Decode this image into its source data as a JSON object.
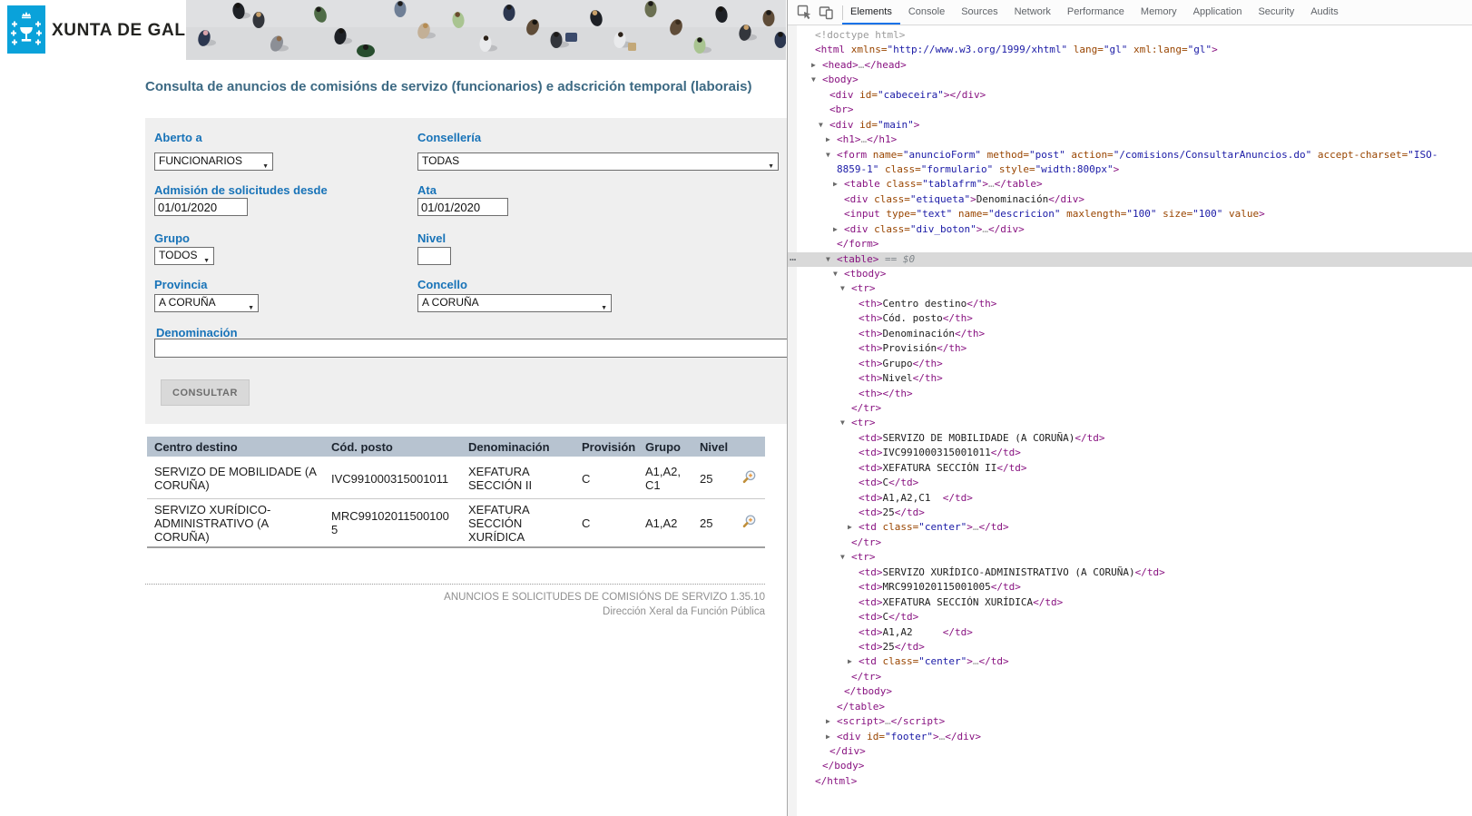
{
  "page": {
    "brand": "XUNTA DE GALICIA",
    "title": "Consulta de anuncios de comisións de servizo (funcionarios) e adscrición temporal (laborais)",
    "form": {
      "fields": [
        {
          "label": "Aberto a",
          "type": "select",
          "value": "FUNCIONARIOS"
        },
        {
          "label": "Consellería",
          "type": "select",
          "value": "TODAS"
        },
        {
          "label": "Admisión de solicitudes desde",
          "type": "text",
          "value": "01/01/2020"
        },
        {
          "label": "Ata",
          "type": "text",
          "value": "01/01/2020"
        },
        {
          "label": "Grupo",
          "type": "select",
          "value": "TODOS"
        },
        {
          "label": "Nivel",
          "type": "text",
          "value": ""
        },
        {
          "label": "Provincia",
          "type": "select",
          "value": "A CORUÑA"
        },
        {
          "label": "Concello",
          "type": "select",
          "value": "A CORUÑA"
        },
        {
          "label": "Denominación",
          "type": "text",
          "value": ""
        }
      ],
      "submit_label": "CONSULTAR"
    },
    "results": {
      "headers": [
        "Centro destino",
        "Cód. posto",
        "Denominación",
        "Provisión",
        "Grupo",
        "Nivel",
        ""
      ],
      "rows": [
        [
          "SERVIZO DE MOBILIDADE (A CORUÑA)",
          "IVC991000315001011",
          "XEFATURA SECCIÓN II",
          "C",
          "A1,A2,C1",
          "25"
        ],
        [
          "SERVIZO XURÍDICO-ADMINISTRATIVO (A CORUÑA)",
          "MRC991020115001005",
          "XEFATURA SECCIÓN XURÍDICA",
          "C",
          "A1,A2",
          "25"
        ]
      ],
      "row_action_icon": "magnifier-plus-icon"
    },
    "footer": {
      "line1": "ANUNCIOS E SOLICITUDES DE COMISIÓNS DE SERVIZO 1.35.10",
      "line2": "Dirección Xeral da Función Pública"
    },
    "colors": {
      "logo_blue": "#0aa2da",
      "label_blue": "#1873b8",
      "title_blue": "#3c6983",
      "form_bg": "#efefef",
      "table_header_bg": "#b7c3d0"
    }
  },
  "devtools": {
    "tabs": [
      "Elements",
      "Console",
      "Sources",
      "Network",
      "Performance",
      "Memory",
      "Application",
      "Security",
      "Audits"
    ],
    "active_tab": "Elements",
    "menu_dots": "…",
    "colors": {
      "tag": "#881280",
      "attr_name": "#994500",
      "attr_value": "#1a1aa6",
      "comment_gray": "#9a9a9a",
      "selection_bg": "#d9d9d9",
      "active_tab_accent": "#1a73e8"
    },
    "tree": [
      [
        0,
        0,
        0,
        [
          [
            "g",
            "<!doctype html>"
          ]
        ]
      ],
      [
        0,
        0,
        0,
        [
          [
            "t",
            "<html"
          ],
          [
            "a",
            " xmlns="
          ],
          [
            "v",
            "\"http://www.w3.org/1999/xhtml\""
          ],
          [
            "a",
            " lang="
          ],
          [
            "v",
            "\"gl\""
          ],
          [
            "a",
            " xml:lang="
          ],
          [
            "v",
            "\"gl\""
          ],
          [
            "t",
            ">"
          ]
        ]
      ],
      [
        1,
        1,
        0,
        [
          [
            "t",
            "<head>"
          ],
          [
            "g",
            "…"
          ],
          [
            "t",
            "</head>"
          ]
        ]
      ],
      [
        1,
        2,
        0,
        [
          [
            "t",
            "<body>"
          ]
        ]
      ],
      [
        2,
        0,
        0,
        [
          [
            "t",
            "<div"
          ],
          [
            "a",
            " id="
          ],
          [
            "v",
            "\"cabeceira\""
          ],
          [
            "t",
            "></div>"
          ]
        ]
      ],
      [
        2,
        0,
        0,
        [
          [
            "t",
            "<br>"
          ]
        ]
      ],
      [
        2,
        2,
        0,
        [
          [
            "t",
            "<div"
          ],
          [
            "a",
            " id="
          ],
          [
            "v",
            "\"main\""
          ],
          [
            "t",
            ">"
          ]
        ]
      ],
      [
        3,
        1,
        0,
        [
          [
            "t",
            "<h1>"
          ],
          [
            "g",
            "…"
          ],
          [
            "t",
            "</h1>"
          ]
        ]
      ],
      [
        3,
        2,
        0,
        [
          [
            "t",
            "<form"
          ],
          [
            "a",
            " name="
          ],
          [
            "v",
            "\"anuncioForm\""
          ],
          [
            "a",
            " method="
          ],
          [
            "v",
            "\"post\""
          ],
          [
            "a",
            " action="
          ],
          [
            "v",
            "\"/comisions/ConsultarAnuncios.do\""
          ],
          [
            "a",
            " accept-charset="
          ],
          [
            "v",
            "\"ISO-"
          ]
        ]
      ],
      [
        3,
        0,
        0,
        [
          [
            "v",
            "8859-1\""
          ],
          [
            "a",
            " class="
          ],
          [
            "v",
            "\"formulario\""
          ],
          [
            "a",
            " style="
          ],
          [
            "v",
            "\"width:800px\""
          ],
          [
            "t",
            ">"
          ]
        ]
      ],
      [
        4,
        1,
        0,
        [
          [
            "t",
            "<table"
          ],
          [
            "a",
            " class="
          ],
          [
            "v",
            "\"tablafrm\""
          ],
          [
            "t",
            ">"
          ],
          [
            "g",
            "…"
          ],
          [
            "t",
            "</table>"
          ]
        ]
      ],
      [
        4,
        0,
        0,
        [
          [
            "t",
            "<div"
          ],
          [
            "a",
            " class="
          ],
          [
            "v",
            "\"etiqueta\""
          ],
          [
            "t",
            ">"
          ],
          [
            "x",
            "Denominación"
          ],
          [
            "t",
            "</div>"
          ]
        ]
      ],
      [
        4,
        0,
        0,
        [
          [
            "t",
            "<input"
          ],
          [
            "a",
            " type="
          ],
          [
            "v",
            "\"text\""
          ],
          [
            "a",
            " name="
          ],
          [
            "v",
            "\"descricion\""
          ],
          [
            "a",
            " maxlength="
          ],
          [
            "v",
            "\"100\""
          ],
          [
            "a",
            " size="
          ],
          [
            "v",
            "\"100\""
          ],
          [
            "a",
            " value"
          ],
          [
            "t",
            ">"
          ]
        ]
      ],
      [
        4,
        1,
        0,
        [
          [
            "t",
            "<div"
          ],
          [
            "a",
            " class="
          ],
          [
            "v",
            "\"div_boton\""
          ],
          [
            "t",
            ">"
          ],
          [
            "g",
            "…"
          ],
          [
            "t",
            "</div>"
          ]
        ]
      ],
      [
        3,
        0,
        0,
        [
          [
            "t",
            "</form>"
          ]
        ]
      ],
      [
        3,
        2,
        1,
        [
          [
            "t",
            "<table>"
          ],
          [
            "s",
            " == "
          ],
          [
            "si",
            "$0"
          ]
        ]
      ],
      [
        4,
        2,
        0,
        [
          [
            "t",
            "<tbody>"
          ]
        ]
      ],
      [
        5,
        2,
        0,
        [
          [
            "t",
            "<tr>"
          ]
        ]
      ],
      [
        6,
        0,
        0,
        [
          [
            "t",
            "<th>"
          ],
          [
            "x",
            "Centro destino"
          ],
          [
            "t",
            "</th>"
          ]
        ]
      ],
      [
        6,
        0,
        0,
        [
          [
            "t",
            "<th>"
          ],
          [
            "x",
            "Cód. posto"
          ],
          [
            "t",
            "</th>"
          ]
        ]
      ],
      [
        6,
        0,
        0,
        [
          [
            "t",
            "<th>"
          ],
          [
            "x",
            "Denominación"
          ],
          [
            "t",
            "</th>"
          ]
        ]
      ],
      [
        6,
        0,
        0,
        [
          [
            "t",
            "<th>"
          ],
          [
            "x",
            "Provisión"
          ],
          [
            "t",
            "</th>"
          ]
        ]
      ],
      [
        6,
        0,
        0,
        [
          [
            "t",
            "<th>"
          ],
          [
            "x",
            "Grupo"
          ],
          [
            "t",
            "</th>"
          ]
        ]
      ],
      [
        6,
        0,
        0,
        [
          [
            "t",
            "<th>"
          ],
          [
            "x",
            "Nivel"
          ],
          [
            "t",
            "</th>"
          ]
        ]
      ],
      [
        6,
        0,
        0,
        [
          [
            "t",
            "<th></th>"
          ]
        ]
      ],
      [
        5,
        0,
        0,
        [
          [
            "t",
            "</tr>"
          ]
        ]
      ],
      [
        5,
        2,
        0,
        [
          [
            "t",
            "<tr>"
          ]
        ]
      ],
      [
        6,
        0,
        0,
        [
          [
            "t",
            "<td>"
          ],
          [
            "x",
            "SERVIZO DE MOBILIDADE (A CORUÑA)"
          ],
          [
            "t",
            "</td>"
          ]
        ]
      ],
      [
        6,
        0,
        0,
        [
          [
            "t",
            "<td>"
          ],
          [
            "x",
            "IVC991000315001011"
          ],
          [
            "t",
            "</td>"
          ]
        ]
      ],
      [
        6,
        0,
        0,
        [
          [
            "t",
            "<td>"
          ],
          [
            "x",
            "XEFATURA SECCIÓN II"
          ],
          [
            "t",
            "</td>"
          ]
        ]
      ],
      [
        6,
        0,
        0,
        [
          [
            "t",
            "<td>"
          ],
          [
            "x",
            "C"
          ],
          [
            "t",
            "</td>"
          ]
        ]
      ],
      [
        6,
        0,
        0,
        [
          [
            "t",
            "<td>"
          ],
          [
            "x",
            "A1,A2,C1  "
          ],
          [
            "t",
            "</td>"
          ]
        ]
      ],
      [
        6,
        0,
        0,
        [
          [
            "t",
            "<td>"
          ],
          [
            "x",
            "25"
          ],
          [
            "t",
            "</td>"
          ]
        ]
      ],
      [
        6,
        1,
        0,
        [
          [
            "t",
            "<td"
          ],
          [
            "a",
            " class="
          ],
          [
            "v",
            "\"center\""
          ],
          [
            "t",
            ">"
          ],
          [
            "g",
            "…"
          ],
          [
            "t",
            "</td>"
          ]
        ]
      ],
      [
        5,
        0,
        0,
        [
          [
            "t",
            "</tr>"
          ]
        ]
      ],
      [
        5,
        2,
        0,
        [
          [
            "t",
            "<tr>"
          ]
        ]
      ],
      [
        6,
        0,
        0,
        [
          [
            "t",
            "<td>"
          ],
          [
            "x",
            "SERVIZO XURÍDICO-ADMINISTRATIVO (A CORUÑA)"
          ],
          [
            "t",
            "</td>"
          ]
        ]
      ],
      [
        6,
        0,
        0,
        [
          [
            "t",
            "<td>"
          ],
          [
            "x",
            "MRC991020115001005"
          ],
          [
            "t",
            "</td>"
          ]
        ]
      ],
      [
        6,
        0,
        0,
        [
          [
            "t",
            "<td>"
          ],
          [
            "x",
            "XEFATURA SECCIÓN XURÍDICA"
          ],
          [
            "t",
            "</td>"
          ]
        ]
      ],
      [
        6,
        0,
        0,
        [
          [
            "t",
            "<td>"
          ],
          [
            "x",
            "C"
          ],
          [
            "t",
            "</td>"
          ]
        ]
      ],
      [
        6,
        0,
        0,
        [
          [
            "t",
            "<td>"
          ],
          [
            "x",
            "A1,A2     "
          ],
          [
            "t",
            "</td>"
          ]
        ]
      ],
      [
        6,
        0,
        0,
        [
          [
            "t",
            "<td>"
          ],
          [
            "x",
            "25"
          ],
          [
            "t",
            "</td>"
          ]
        ]
      ],
      [
        6,
        1,
        0,
        [
          [
            "t",
            "<td"
          ],
          [
            "a",
            " class="
          ],
          [
            "v",
            "\"center\""
          ],
          [
            "t",
            ">"
          ],
          [
            "g",
            "…"
          ],
          [
            "t",
            "</td>"
          ]
        ]
      ],
      [
        5,
        0,
        0,
        [
          [
            "t",
            "</tr>"
          ]
        ]
      ],
      [
        4,
        0,
        0,
        [
          [
            "t",
            "</tbody>"
          ]
        ]
      ],
      [
        3,
        0,
        0,
        [
          [
            "t",
            "</table>"
          ]
        ]
      ],
      [
        3,
        1,
        0,
        [
          [
            "t",
            "<script>"
          ],
          [
            "g",
            "…"
          ],
          [
            "t",
            "</script>"
          ]
        ]
      ],
      [
        3,
        1,
        0,
        [
          [
            "t",
            "<div"
          ],
          [
            "a",
            " id="
          ],
          [
            "v",
            "\"footer\""
          ],
          [
            "t",
            ">"
          ],
          [
            "g",
            "…"
          ],
          [
            "t",
            "</div>"
          ]
        ]
      ],
      [
        2,
        0,
        0,
        [
          [
            "t",
            "</div>"
          ]
        ]
      ],
      [
        1,
        0,
        0,
        [
          [
            "t",
            "</body>"
          ]
        ]
      ],
      [
        0,
        0,
        0,
        [
          [
            "t",
            "</html>"
          ]
        ]
      ]
    ]
  }
}
